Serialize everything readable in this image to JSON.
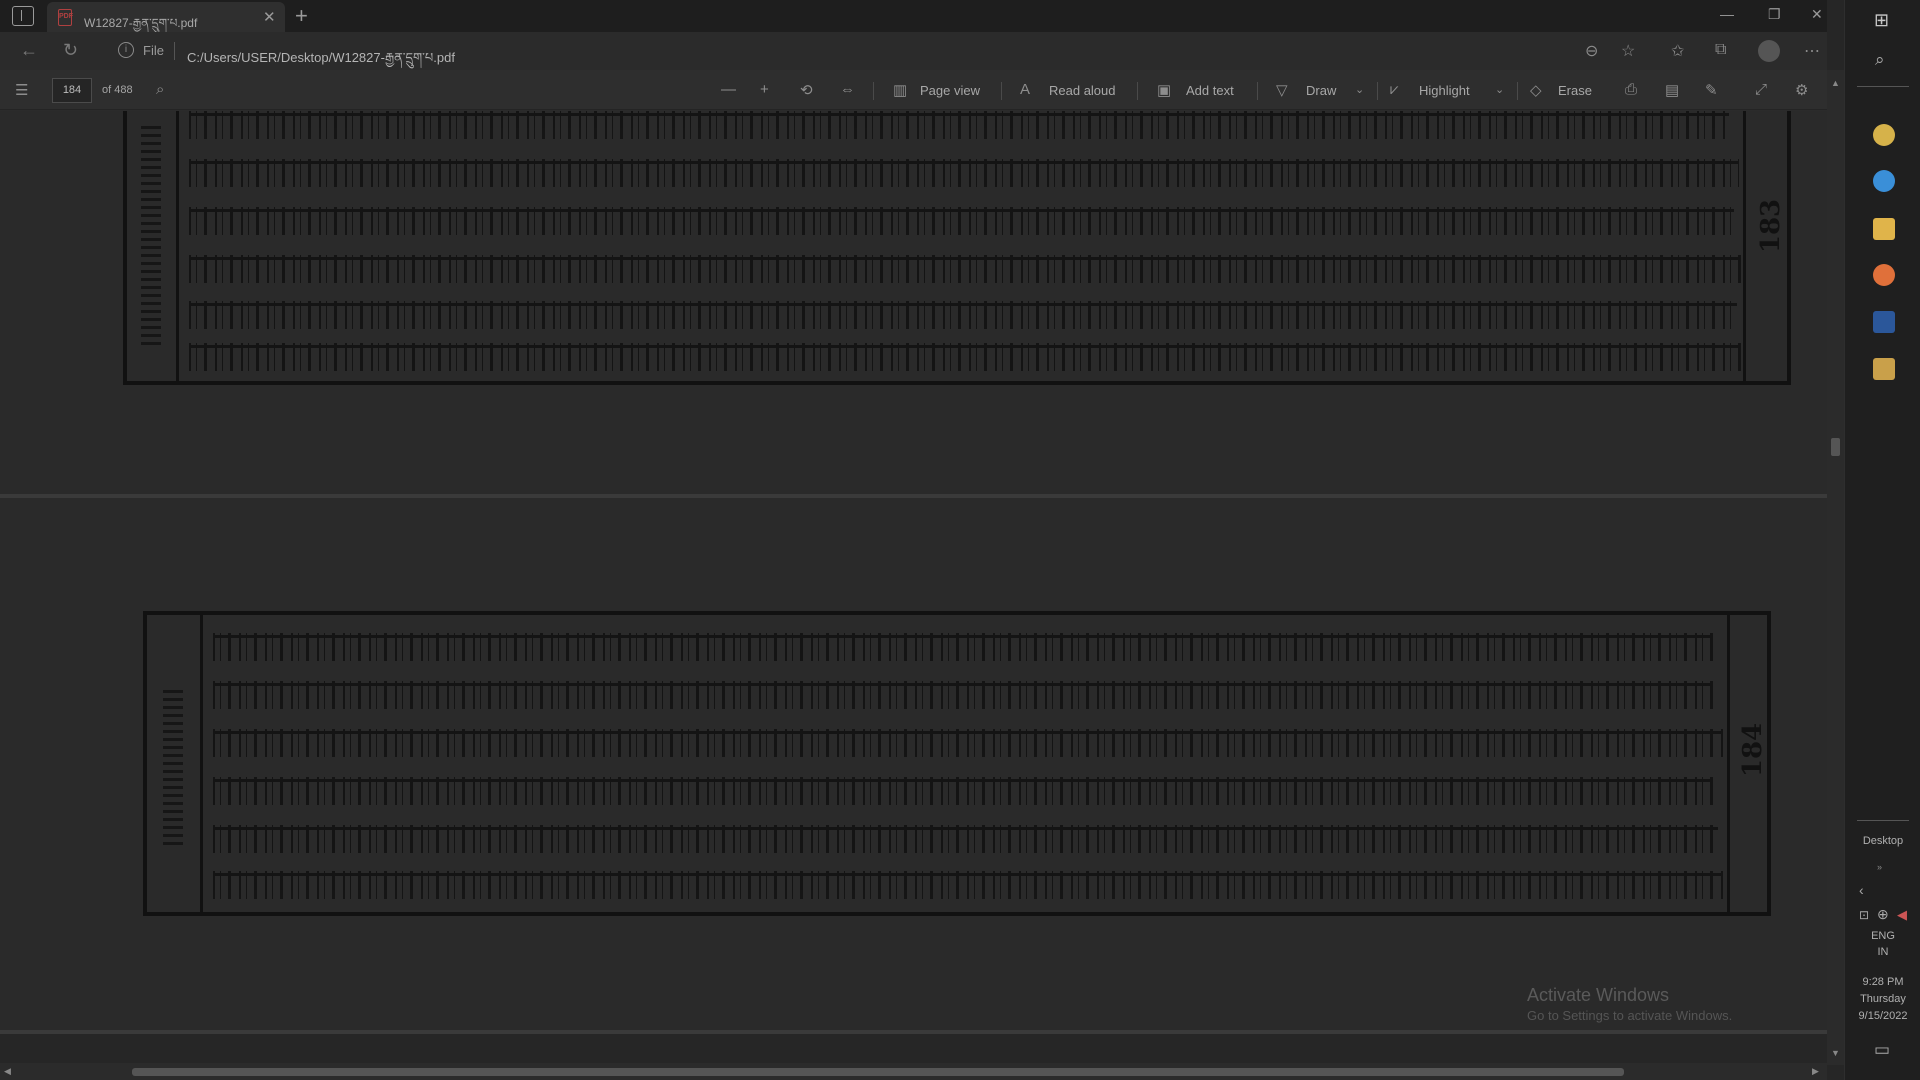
{
  "browser": {
    "tab_title": "W12827-རྒྱན་དྲུག་པ.pdf",
    "new_tab_symbol": "+",
    "file_label": "File",
    "url": "C:/Users/USER/Desktop/W12827-རྒྱན་དྲུག་པ.pdf"
  },
  "pdf_toolbar": {
    "page_number": "184",
    "page_total": "of 488",
    "page_view_label": "Page view",
    "read_aloud_label": "Read aloud",
    "add_text_label": "Add text",
    "draw_label": "Draw",
    "highlight_label": "Highlight",
    "erase_label": "Erase"
  },
  "document": {
    "folio_top_number": "183",
    "folio_bottom_number": "184"
  },
  "watermark": {
    "title": "Activate Windows",
    "subtitle": "Go to Settings to activate Windows."
  },
  "taskbar": {
    "desktop_label": "Desktop",
    "language": "ENG",
    "region": "IN",
    "time": "9:28 PM",
    "day": "Thursday",
    "date": "9/15/2022"
  },
  "icons": {
    "app_colors": [
      "#d6b24a",
      "#3a8fd8",
      "#e0b44a",
      "#e0703a",
      "#2b579a",
      "#c9a04a"
    ]
  }
}
